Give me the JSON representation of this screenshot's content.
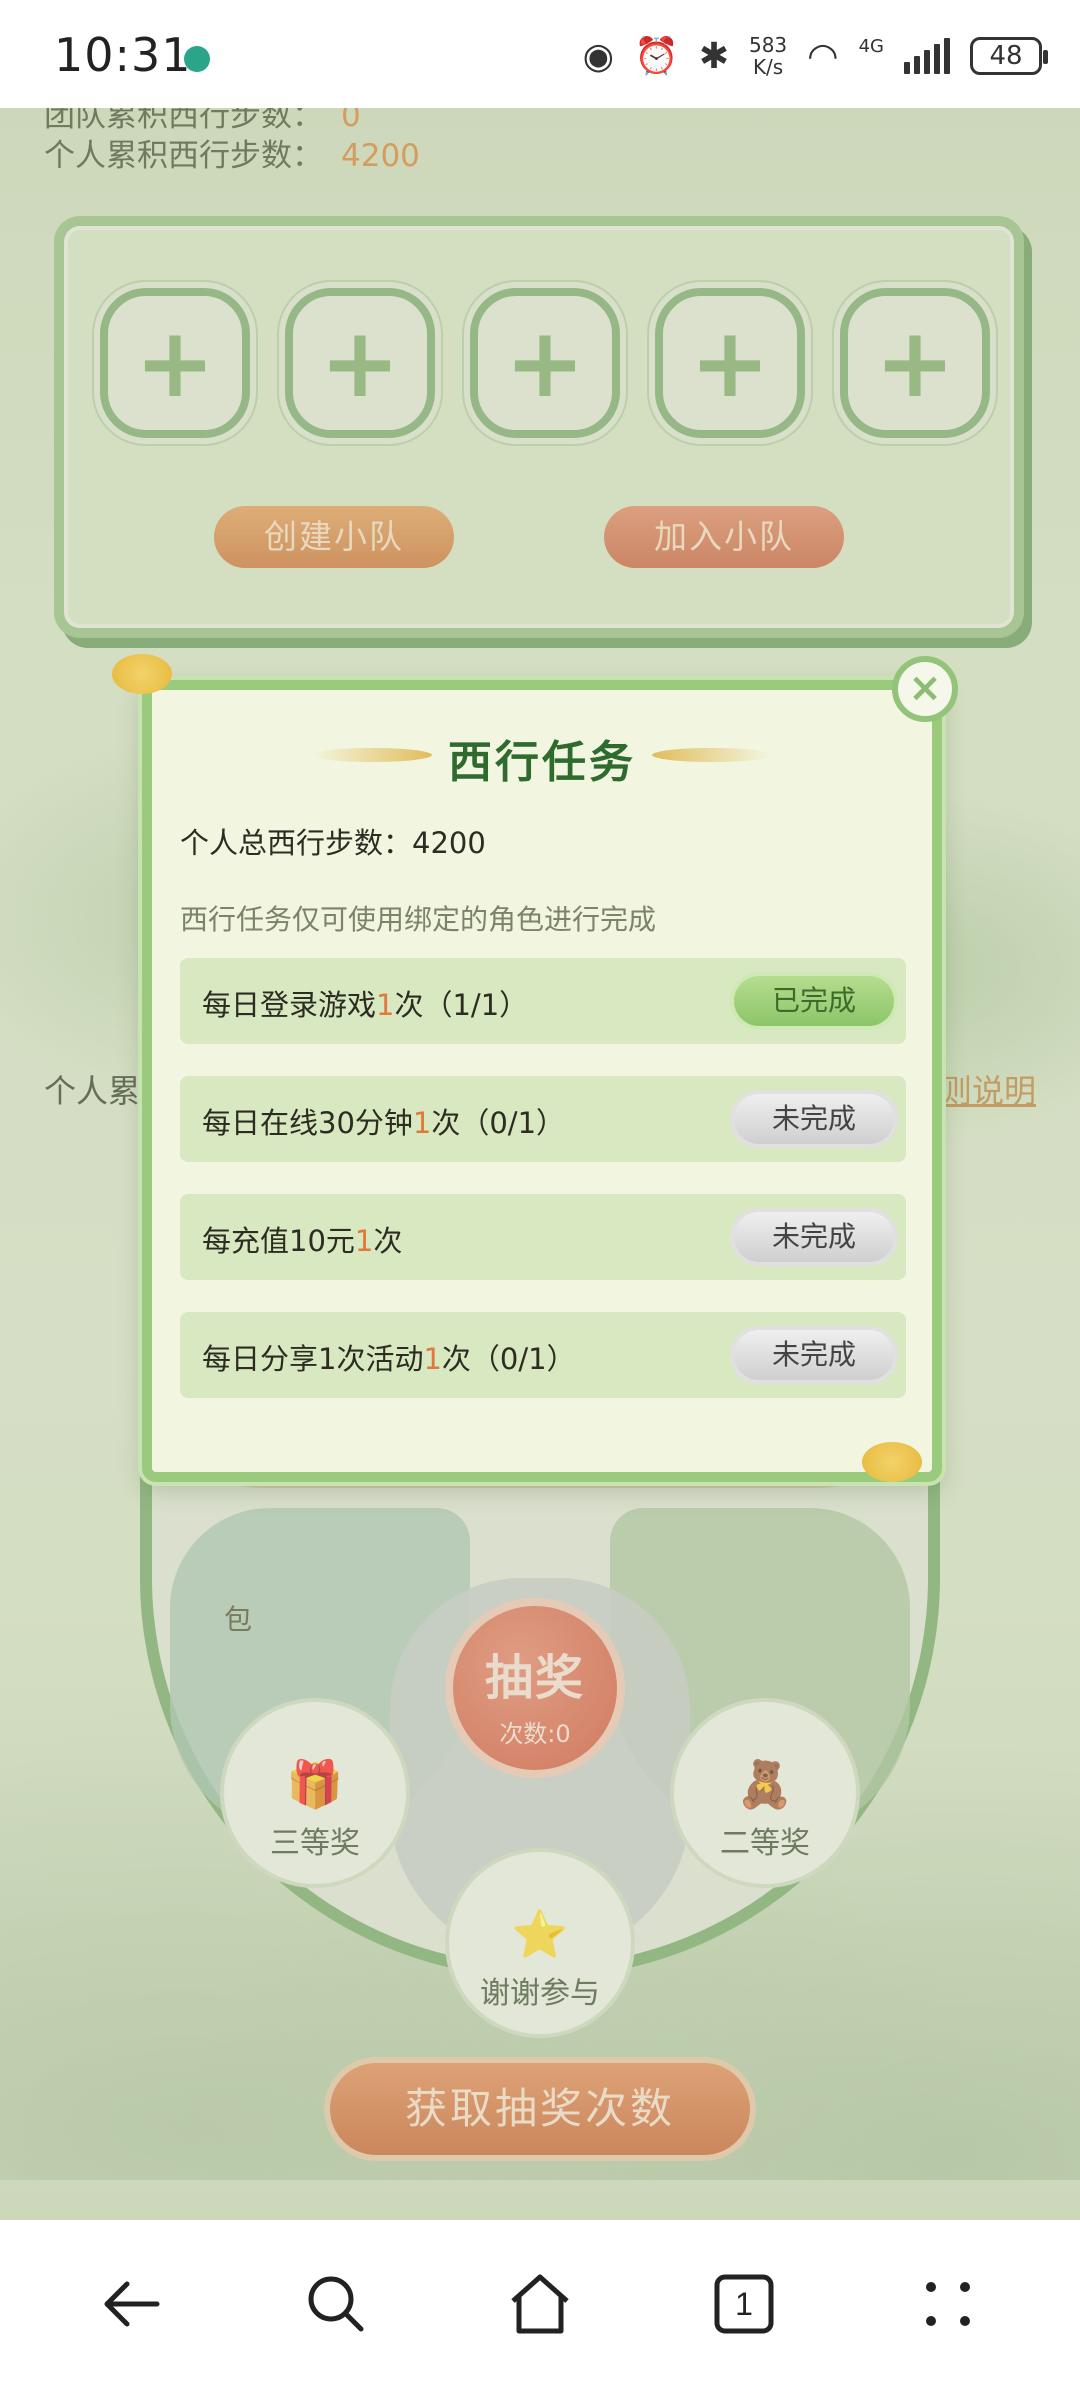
{
  "status_bar": {
    "time": "10:31",
    "speed_top": "583",
    "speed_bottom": "K/s",
    "network": "4G",
    "battery": "48"
  },
  "stats": {
    "team_steps_label": "团队累积西行步数：",
    "team_steps_value": "0",
    "personal_steps_label": "个人累积西行步数：",
    "personal_steps_value": "4200"
  },
  "team": {
    "slot_count": 5,
    "create_label": "创建小队",
    "join_label": "加入小队"
  },
  "page": {
    "personal_partial": "个人累",
    "rules_partial": "则说明",
    "bag_partial": "包"
  },
  "wheel": {
    "draw_label": "抽奖",
    "draw_count": "次数:0",
    "third_prize": "三等奖",
    "second_prize": "二等奖",
    "thanks": "谢谢参与"
  },
  "get_chances_label": "获取抽奖次数",
  "modal": {
    "title": "西行任务",
    "total_label": "个人总西行步数：4200",
    "note": "西行任务仅可使用绑定的角色进行完成",
    "tasks": [
      {
        "pre": "每日登录游戏",
        "hl": "1",
        "post": "次（1/1）",
        "status": "已完成"
      },
      {
        "pre": "每日在线30分钟",
        "hl": "1",
        "post": "次（0/1）",
        "status": "未完成"
      },
      {
        "pre": "每充值10元",
        "hl": "1",
        "post": "次",
        "status": "未完成"
      },
      {
        "pre": "每日分享1次活动",
        "hl": "1",
        "post": "次（0/1）",
        "status": "未完成"
      }
    ],
    "close_glyph": "×"
  },
  "navbar": {
    "tab_count": "1"
  }
}
